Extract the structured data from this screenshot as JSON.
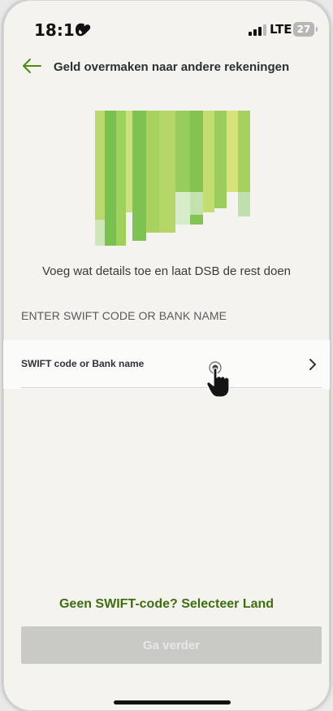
{
  "status_bar": {
    "time": "18:16",
    "network": "LTE",
    "battery": "27"
  },
  "header": {
    "title": "Geld overmaken naar andere rekeningen",
    "back_icon": "arrow-left-icon"
  },
  "subtitle": "Voeg wat details toe en laat DSB de rest doen",
  "section_label": "ENTER SWIFT CODE OR BANK NAME",
  "swift_row": {
    "label": "SWIFT code or Bank name",
    "icon": "chevron-right-icon"
  },
  "no_swift_link": "Geen SWIFT-code? Selecteer Land",
  "continue_button": {
    "label": "Ga verder",
    "enabled": false
  },
  "colors": {
    "background": "#f4f3ee",
    "accent_green": "#3f6d12",
    "button_disabled": "#c9c9c6"
  }
}
